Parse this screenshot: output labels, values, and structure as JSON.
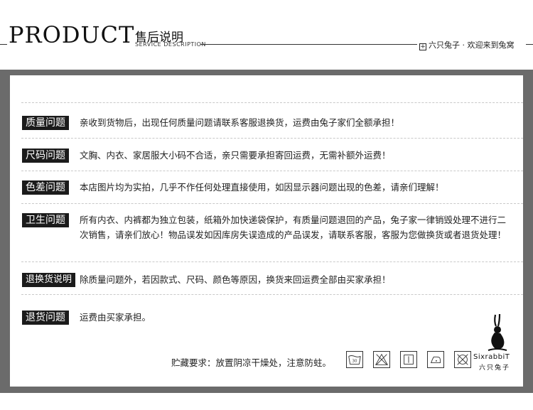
{
  "header": {
    "brand": "PRODUCT",
    "title_cn": "售后说明",
    "title_en": "SERVICE DESCRIPTION",
    "slogan": "六只兔子 · 欢迎来到兔窝",
    "slogan_icon": "plus-square-icon"
  },
  "colors": {
    "frame": "#6b6b6b",
    "label_bg": "#1b1b1b",
    "label_fg": "#ffffff",
    "text": "#222222"
  },
  "rows": [
    {
      "label": "质量问题",
      "text": "亲收到货物后，出现任何质量问题请联系客服退换货，运费由兔子家们全额承担！"
    },
    {
      "label": "尺码问题",
      "text": "文胸、内衣、家居服大小码不合适，亲只需要承担寄回运费，无需补额外运费！"
    },
    {
      "label": "色差问题",
      "text": "本店图片均为实拍，几乎不作任何处理直接使用，如因显示器问题出现的色差，请亲们理解！"
    },
    {
      "label": "卫生问题",
      "text": "所有内衣、内裤都为独立包装，纸箱外加快递袋保护，有质量问题退回的产品，兔子家一律销毁处理不进行二次销售，请亲们放心！物品误发如因库房失误造成的产品误发，请联系客服，客服为您做换货或者退货处理！"
    },
    {
      "label": "退换货说明",
      "text": "除质量问题外，若因款式、尺码、颜色等原因，换货来回运费全部由买家承担！"
    },
    {
      "label": "退货问题",
      "text": "运费由买家承担。"
    }
  ],
  "storage_note": "贮藏要求：放置阴凉干燥处，注意防蛀。",
  "care_icons": [
    {
      "name": "wash-30-icon",
      "label": "30"
    },
    {
      "name": "no-bleach-icon"
    },
    {
      "name": "hang-dry-icon"
    },
    {
      "name": "iron-low-icon"
    },
    {
      "name": "no-dry-clean-icon"
    }
  ],
  "logo": {
    "name": "rabbit-logo-icon",
    "text": "SixrabbiT",
    "text_cn": "六只兔子"
  }
}
